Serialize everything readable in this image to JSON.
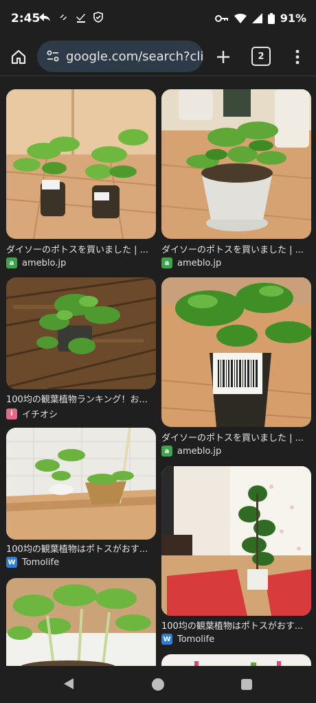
{
  "status_bar": {
    "time": "2:45",
    "battery": "91%",
    "icons_left": [
      "share-arrow-icon",
      "signal-app-icon",
      "download-done-icon",
      "shield-icon"
    ],
    "icons_right": [
      "vpn-key-icon",
      "wifi-icon",
      "cell-signal-icon",
      "battery-icon"
    ]
  },
  "toolbar": {
    "url": "google.com/search?clier",
    "tab_count": "2"
  },
  "results": [
    {
      "caption": "ダイソーのポトスを買いました | ...",
      "source": "ameblo.jp",
      "favicon_color": "#3fa34d"
    },
    {
      "caption": "ダイソーのポトスを買いました | ...",
      "source": "ameblo.jp",
      "favicon_color": "#3fa34d"
    },
    {
      "caption": "100均の観葉植物ランキング！お...",
      "source": "イチオシ",
      "favicon_color": "#e46a8a"
    },
    {
      "caption": "ダイソーのポトスを買いました | ...",
      "source": "ameblo.jp",
      "favicon_color": "#3fa34d"
    },
    {
      "caption": "100均の観葉植物はポトスがおす...",
      "source": "Tomolife",
      "favicon_color": "#2f7fd1"
    },
    {
      "caption": "100均の観葉植物はポトスがおす...",
      "source": "Tomolife",
      "favicon_color": "#2f7fd1"
    }
  ],
  "nav_bar": {
    "buttons": [
      "back-icon",
      "home-icon",
      "recents-icon"
    ]
  }
}
